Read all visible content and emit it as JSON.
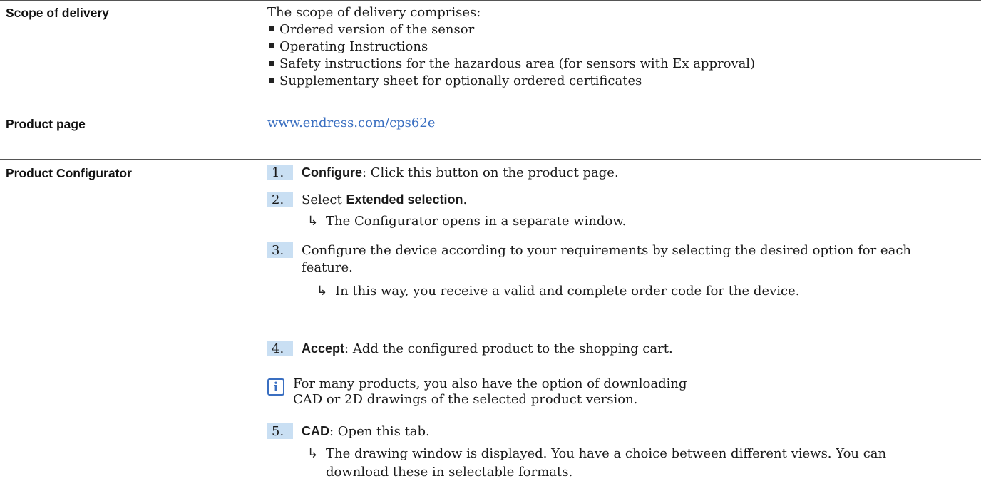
{
  "scope": {
    "label": "Scope of delivery",
    "intro": "The scope of delivery comprises:",
    "items": [
      "Ordered version of the sensor",
      "Operating Instructions",
      "Safety instructions for the hazardous area (for sensors with Ex approval)",
      "Supplementary sheet for optionally ordered certificates"
    ]
  },
  "product_page": {
    "label": "Product page",
    "link": "www.endress.com/cps62e"
  },
  "configurator": {
    "label": "Product Configurator",
    "steps": [
      {
        "num": "1.",
        "bold": "Configure",
        "text": ": Click this button on the product page."
      },
      {
        "num": "2.",
        "pre": "Select ",
        "bold": "Extended selection",
        "text": ".",
        "result": "The Configurator opens in a separate window."
      },
      {
        "num": "3.",
        "text_line1": "Configure the device according to your requirements by selecting the desired option for each",
        "text_line2": "feature.",
        "result": "In this way, you receive a valid and complete order code for the device."
      },
      {
        "num": "4.",
        "bold": "Accept",
        "text": ": Add the configured product to the shopping cart."
      },
      {
        "num": "5.",
        "bold": "CAD",
        "text": ": Open this tab.",
        "result_line1": "The drawing window is displayed. You have a choice between different views. You can",
        "result_line2": "download these in selectable formats."
      }
    ],
    "note": "For many products, you also have the option of downloading CAD or 2D drawings of the selected product version."
  }
}
